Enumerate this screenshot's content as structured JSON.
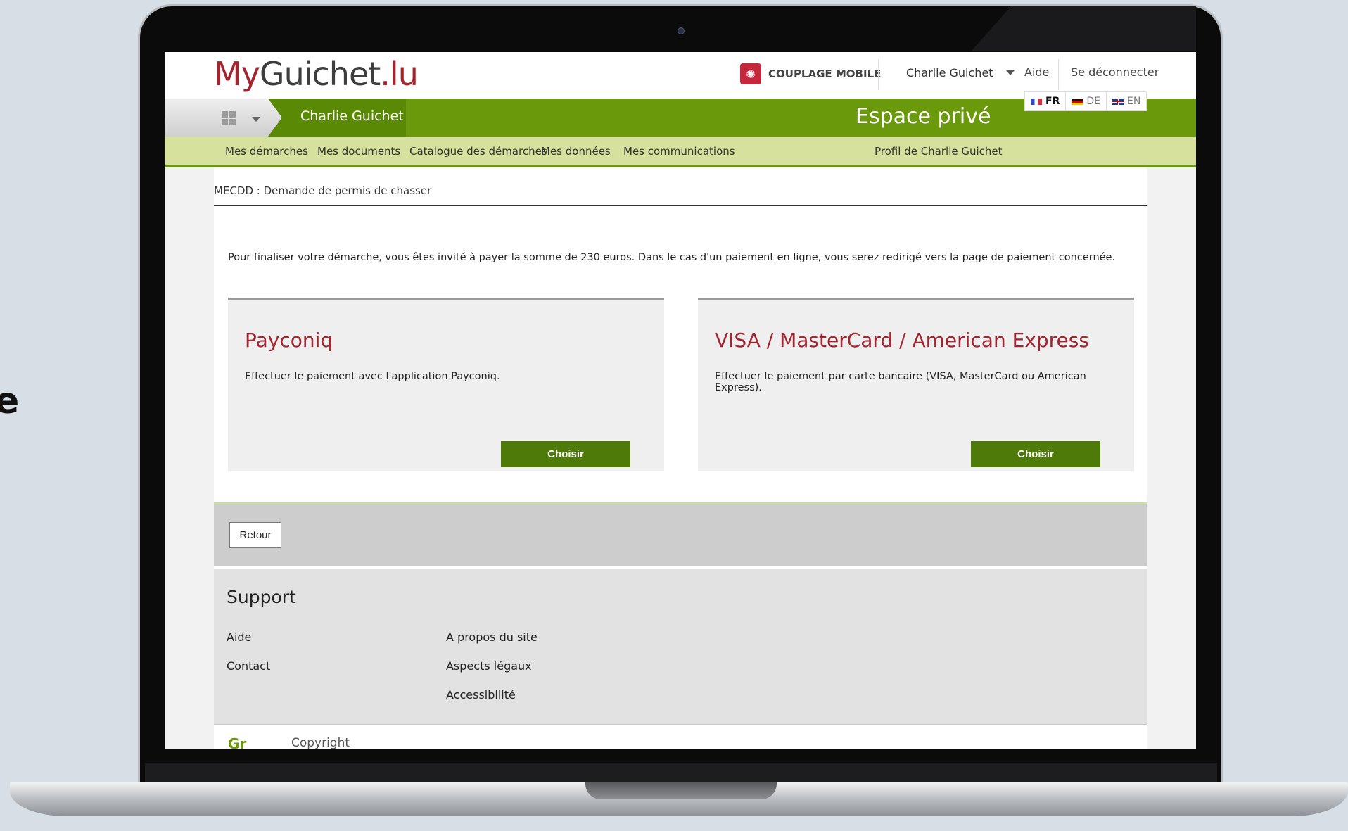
{
  "side_fragment": "e",
  "header": {
    "logo_part1": "My",
    "logo_part2": "Guichet",
    "logo_part3": ".lu",
    "coupling_label": "COUPLAGE MOBILE",
    "coupling_icon": "mobile-coupling-icon",
    "user_name": "Charlie Guichet",
    "help": "Aide",
    "logout": "Se déconnecter"
  },
  "greenbar": {
    "active_user": "Charlie Guichet",
    "space_title": "Espace privé",
    "languages": [
      {
        "code": "FR",
        "active": true
      },
      {
        "code": "DE",
        "active": false
      },
      {
        "code": "EN",
        "active": false
      }
    ]
  },
  "nav": {
    "items": [
      "Mes démarches",
      "Mes documents",
      "Catalogue des démarches",
      "Mes données",
      "Mes communications"
    ],
    "profile": "Profil de Charlie Guichet"
  },
  "breadcrumb": "MECDD : Demande de permis de chasser",
  "intro": "Pour finaliser votre démarche, vous êtes invité à payer la somme de 230 euros. Dans le cas d'un paiement en ligne, vous serez redirigé vers la page de paiement concernée.",
  "payments": [
    {
      "title": "Payconiq",
      "description": "Effectuer le paiement avec l'application Payconiq.",
      "button": "Choisir"
    },
    {
      "title": "VISA / MasterCard / American Express",
      "description": "Effectuer le paiement par carte bancaire (VISA, MasterCard ou American Express).",
      "button": "Choisir"
    }
  ],
  "back_button": "Retour",
  "support": {
    "title": "Support",
    "col1": [
      "Aide",
      "Contact"
    ],
    "col2": [
      "A propos du site",
      "Aspects légaux",
      "Accessibilité"
    ]
  },
  "footer_peek": {
    "logo": "Gr",
    "text": "Copyright"
  },
  "colors": {
    "brand_red": "#a3232e",
    "brand_green": "#6a9a0c",
    "nav_bg": "#d6e19d",
    "button_green": "#4e7a0a"
  }
}
